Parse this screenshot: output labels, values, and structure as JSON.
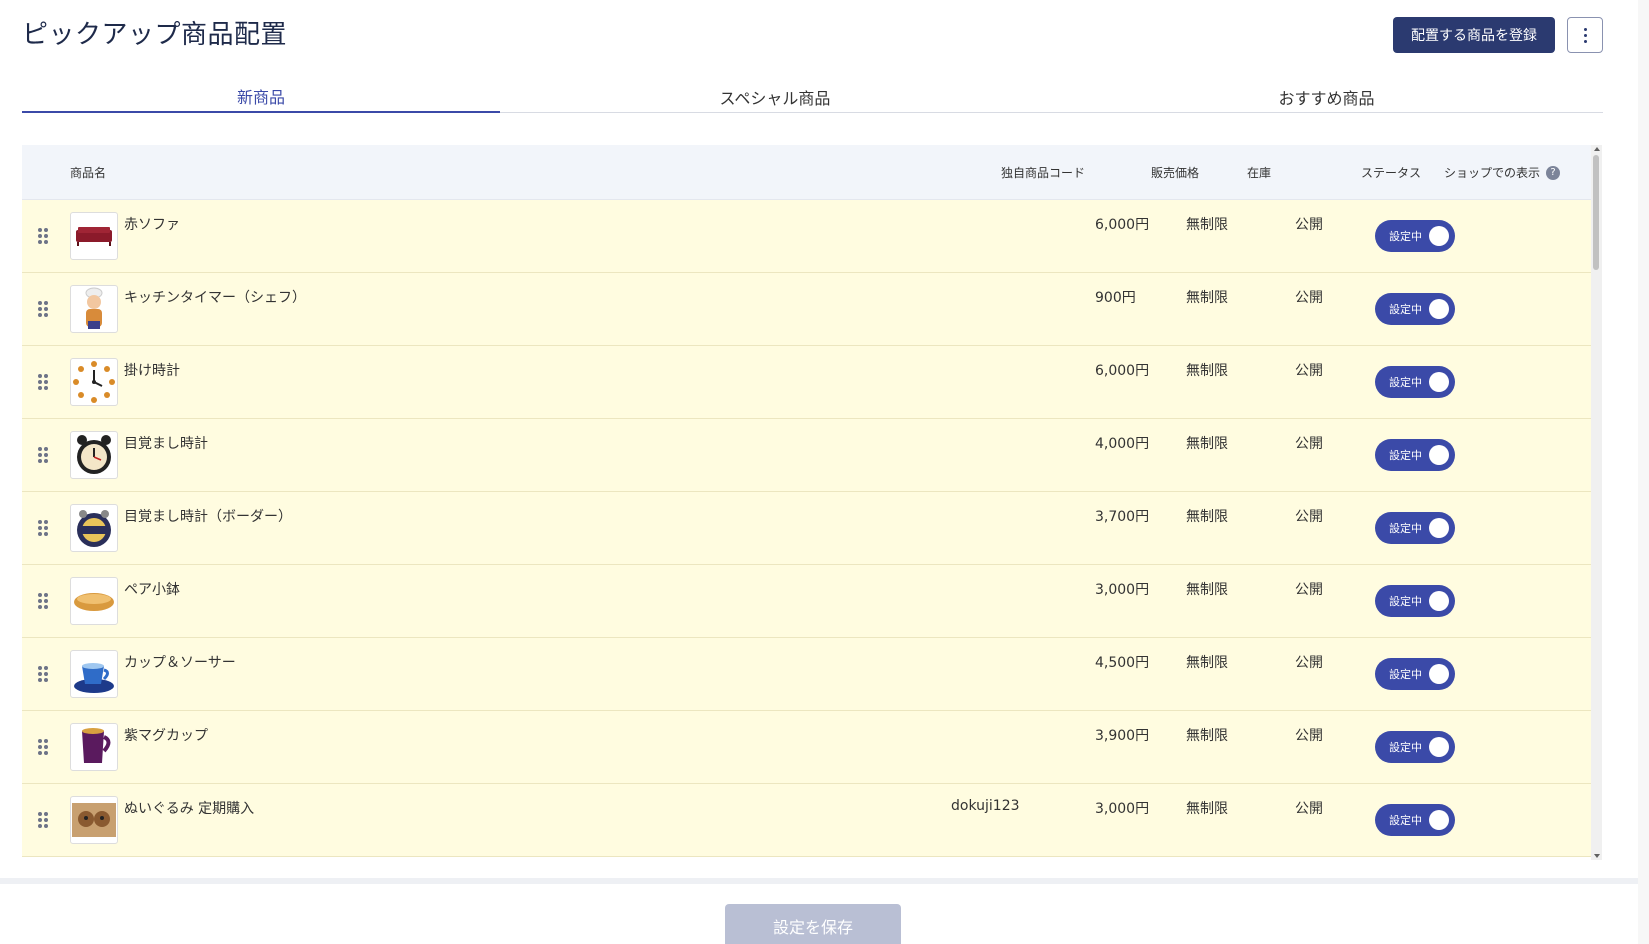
{
  "header": {
    "title": "ピックアップ商品配置",
    "register_label": "配置する商品を登録",
    "more_icon": "kebab-menu-icon"
  },
  "tabs": [
    {
      "label": "新商品",
      "active": true
    },
    {
      "label": "スペシャル商品",
      "active": false
    },
    {
      "label": "おすすめ商品",
      "active": false
    }
  ],
  "table": {
    "columns": {
      "name": "商品名",
      "code": "独自商品コード",
      "price": "販売価格",
      "stock": "在庫",
      "status": "ステータス",
      "display": "ショップでの表示",
      "help": "?"
    },
    "rows": [
      {
        "name": "赤ソファ",
        "code": "",
        "price": "6,000円",
        "stock": "無制限",
        "status": "公開",
        "toggle": "設定中",
        "thumb": "sofa"
      },
      {
        "name": "キッチンタイマー（シェフ）",
        "code": "",
        "price": "900円",
        "stock": "無制限",
        "status": "公開",
        "toggle": "設定中",
        "thumb": "chef"
      },
      {
        "name": "掛け時計",
        "code": "",
        "price": "6,000円",
        "stock": "無制限",
        "status": "公開",
        "toggle": "設定中",
        "thumb": "wallclock"
      },
      {
        "name": "目覚まし時計",
        "code": "",
        "price": "4,000円",
        "stock": "無制限",
        "status": "公開",
        "toggle": "設定中",
        "thumb": "alarm"
      },
      {
        "name": "目覚まし時計（ボーダー）",
        "code": "",
        "price": "3,700円",
        "stock": "無制限",
        "status": "公開",
        "toggle": "設定中",
        "thumb": "alarm2"
      },
      {
        "name": "ペア小鉢",
        "code": "",
        "price": "3,000円",
        "stock": "無制限",
        "status": "公開",
        "toggle": "設定中",
        "thumb": "bowl"
      },
      {
        "name": "カップ＆ソーサー",
        "code": "",
        "price": "4,500円",
        "stock": "無制限",
        "status": "公開",
        "toggle": "設定中",
        "thumb": "cup"
      },
      {
        "name": "紫マグカップ",
        "code": "",
        "price": "3,900円",
        "stock": "無制限",
        "status": "公開",
        "toggle": "設定中",
        "thumb": "mug"
      },
      {
        "name": "ぬいぐるみ 定期購入",
        "code": "dokuji123",
        "price": "3,000円",
        "stock": "無制限",
        "status": "公開",
        "toggle": "設定中",
        "thumb": "plush"
      }
    ]
  },
  "footer": {
    "save_label": "設定を保存"
  },
  "colors": {
    "primary": "#2b3a70",
    "toggle": "#3b4aa8",
    "row_bg": "#fffce0",
    "header_bg": "#f2f5fa",
    "save_disabled": "#b9bfd4"
  }
}
